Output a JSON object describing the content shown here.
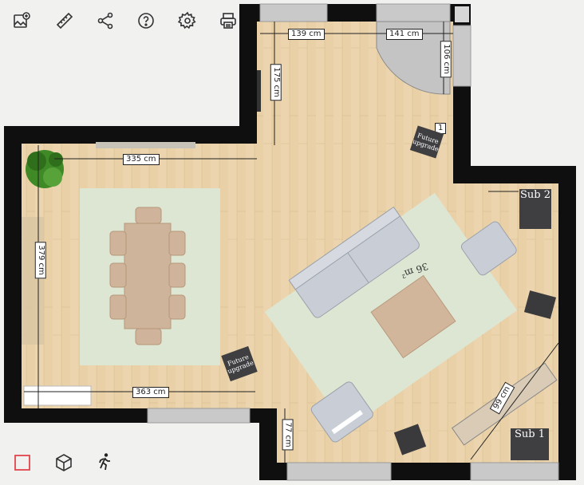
{
  "toolbar": {
    "icons": [
      "add-image-icon",
      "ruler-icon",
      "share-icon",
      "help-icon",
      "settings-icon",
      "print-icon"
    ]
  },
  "bottom_bar": {
    "icons": [
      "2d-square-icon",
      "3d-cube-icon",
      "walk-icon"
    ]
  },
  "colors": {
    "wall": "#0f0f0f",
    "floor": "#e8cfa6",
    "rug": "#dde6d3",
    "sofa": "#c9ced6",
    "furniture": "#cdb49a",
    "tag_bg": "#3f3e40",
    "window": "#c9c9c9"
  },
  "plan": {
    "dimensions": {
      "d139": "139 cm",
      "d141": "141 cm",
      "d106": "106 cm",
      "d175": "175 cm",
      "d335": "335 cm",
      "d379": "379 cm",
      "d363": "363 cm",
      "d77": "77 cm",
      "d99": "99 cm",
      "d1": "1"
    },
    "tags": {
      "future1": "Future upgrade",
      "future2": "Future upgrade"
    },
    "subs": {
      "sub1": "Sub 1",
      "sub2": "Sub 2"
    },
    "area": "36 m²"
  }
}
